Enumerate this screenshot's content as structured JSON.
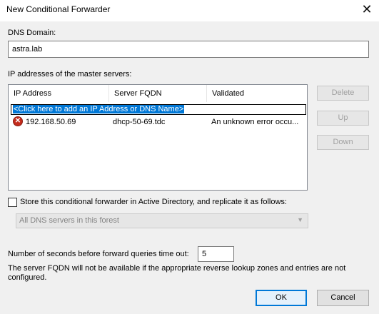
{
  "window": {
    "title": "New Conditional Forwarder",
    "close_glyph": "✕"
  },
  "dns_domain": {
    "label": "DNS Domain:",
    "value": "astra.lab"
  },
  "master_servers": {
    "label": "IP addresses of the master servers:",
    "columns": [
      "IP Address",
      "Server FQDN",
      "Validated"
    ],
    "add_prompt": "<Click here to add an IP Address or DNS Name>",
    "rows": [
      {
        "status_icon": "error-icon",
        "ip": "192.168.50.69",
        "fqdn": "dhcp-50-69.tdc",
        "validated": "An unknown error occu..."
      }
    ]
  },
  "side_buttons": {
    "delete": "Delete",
    "up": "Up",
    "down": "Down"
  },
  "store_ad": {
    "label": "Store this conditional forwarder in Active Directory, and replicate it as follows:",
    "checked": false,
    "replication_value": "All DNS servers in this forest"
  },
  "timeout": {
    "label": "Number of seconds before forward queries time out:",
    "value": "5"
  },
  "note": "The server FQDN will not be available if the appropriate reverse lookup zones and entries are not configured.",
  "footer": {
    "ok": "OK",
    "cancel": "Cancel"
  },
  "colors": {
    "selection": "#0078d7",
    "error": "#c42b1c",
    "background": "#f0f0f0"
  }
}
